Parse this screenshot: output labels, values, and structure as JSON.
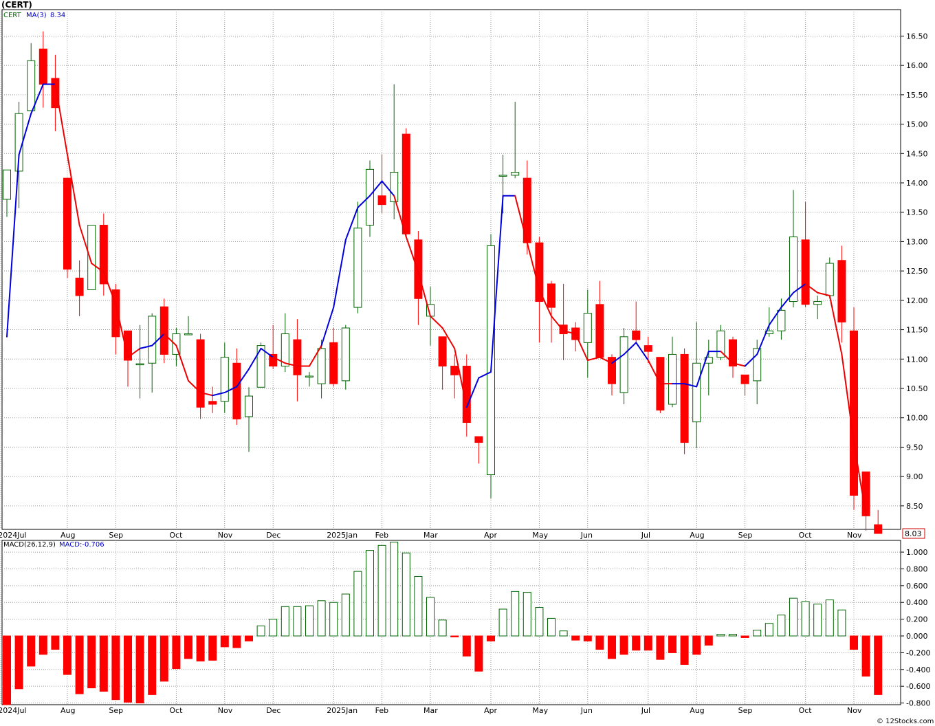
{
  "title": "(CERT)",
  "footer": "© 12Stocks.com",
  "chart_data": [
    {
      "type": "candlestick",
      "legend": {
        "symbol": "CERT",
        "ma_label": "MA(3)",
        "ma_value": "8.34"
      },
      "last_price": "8.03",
      "ylim": [
        8.1,
        16.95
      ],
      "yticks": [
        8.5,
        9.0,
        9.5,
        10.0,
        10.5,
        11.0,
        11.5,
        12.0,
        12.5,
        13.0,
        13.5,
        14.0,
        14.5,
        15.0,
        15.5,
        16.0,
        16.5
      ],
      "ytick_labels": [
        "8.50",
        "9.00",
        "9.50",
        "10.00",
        "10.50",
        "11.00",
        "11.50",
        "12.00",
        "12.50",
        "13.00",
        "13.50",
        "14.00",
        "14.50",
        "15.00",
        "15.50",
        "16.00",
        "16.50"
      ],
      "x_labels": [
        {
          "label": "2024Jul",
          "i": -0.5
        },
        {
          "label": "Aug",
          "i": 5
        },
        {
          "label": "Sep",
          "i": 9
        },
        {
          "label": "Oct",
          "i": 14
        },
        {
          "label": "Nov",
          "i": 18
        },
        {
          "label": "Dec",
          "i": 22
        },
        {
          "label": "2025Jan",
          "i": 27
        },
        {
          "label": "Feb",
          "i": 31
        },
        {
          "label": "Mar",
          "i": 35
        },
        {
          "label": "Apr",
          "i": 40
        },
        {
          "label": "May",
          "i": 44
        },
        {
          "label": "Jun",
          "i": 48
        },
        {
          "label": "Jul",
          "i": 53
        },
        {
          "label": "Aug",
          "i": 57
        },
        {
          "label": "Sep",
          "i": 61
        },
        {
          "label": "Oct",
          "i": 66
        },
        {
          "label": "Nov",
          "i": 70
        }
      ],
      "candles": [
        [
          13.72,
          14.22,
          13.42,
          14.22
        ],
        [
          14.2,
          15.38,
          13.57,
          15.18
        ],
        [
          15.23,
          16.38,
          15.23,
          16.08
        ],
        [
          16.28,
          16.58,
          15.28,
          15.68
        ],
        [
          15.78,
          16.18,
          14.88,
          15.28
        ],
        [
          14.08,
          14.08,
          12.38,
          12.53
        ],
        [
          12.38,
          12.68,
          11.73,
          12.08
        ],
        [
          12.18,
          13.28,
          12.18,
          13.28
        ],
        [
          13.28,
          13.48,
          12.08,
          12.28
        ],
        [
          12.18,
          12.28,
          11.08,
          11.38
        ],
        [
          11.48,
          11.48,
          10.53,
          10.98
        ],
        [
          10.92,
          11.58,
          10.33,
          10.92
        ],
        [
          10.93,
          11.78,
          10.43,
          11.73
        ],
        [
          11.89,
          12.03,
          10.93,
          11.08
        ],
        [
          11.08,
          11.53,
          10.88,
          11.43
        ],
        [
          11.43,
          11.73,
          11.43,
          11.43
        ],
        [
          11.33,
          11.43,
          9.98,
          10.18
        ],
        [
          10.28,
          10.53,
          10.08,
          10.23
        ],
        [
          10.28,
          11.28,
          10.08,
          11.03
        ],
        [
          10.93,
          11.18,
          9.88,
          9.98
        ],
        [
          10.02,
          10.52,
          9.42,
          10.37
        ],
        [
          10.52,
          11.28,
          10.52,
          11.23
        ],
        [
          11.08,
          11.58,
          10.83,
          10.88
        ],
        [
          10.88,
          11.78,
          10.78,
          11.43
        ],
        [
          11.33,
          11.68,
          10.28,
          10.73
        ],
        [
          10.71,
          10.78,
          10.53,
          10.71
        ],
        [
          10.58,
          11.33,
          10.33,
          11.18
        ],
        [
          11.28,
          11.53,
          10.53,
          10.58
        ],
        [
          10.63,
          11.58,
          10.48,
          11.53
        ],
        [
          11.88,
          13.68,
          11.78,
          13.23
        ],
        [
          13.28,
          14.38,
          13.08,
          14.23
        ],
        [
          13.78,
          14.48,
          13.48,
          13.63
        ],
        [
          13.68,
          15.68,
          13.38,
          14.18
        ],
        [
          14.83,
          14.93,
          13.08,
          13.13
        ],
        [
          13.03,
          13.18,
          11.58,
          12.03
        ],
        [
          11.73,
          12.23,
          11.23,
          11.93
        ],
        [
          11.38,
          11.38,
          10.48,
          10.88
        ],
        [
          10.88,
          11.08,
          10.33,
          10.73
        ],
        [
          10.88,
          11.08,
          9.68,
          9.92
        ],
        [
          9.68,
          9.68,
          9.22,
          9.58
        ],
        [
          9.03,
          13.13,
          8.63,
          12.93
        ],
        [
          14.13,
          14.48,
          13.48,
          14.13
        ],
        [
          14.13,
          15.38,
          14.08,
          14.18
        ],
        [
          14.08,
          14.38,
          12.78,
          12.98
        ],
        [
          12.98,
          13.08,
          11.28,
          11.98
        ],
        [
          12.28,
          12.33,
          11.28,
          11.88
        ],
        [
          11.58,
          12.28,
          10.98,
          11.43
        ],
        [
          11.53,
          11.63,
          11.13,
          11.33
        ],
        [
          11.28,
          12.18,
          10.68,
          11.78
        ],
        [
          11.93,
          12.33,
          11.03,
          11.03
        ],
        [
          11.03,
          11.08,
          10.38,
          10.58
        ],
        [
          10.43,
          11.53,
          10.23,
          11.38
        ],
        [
          11.48,
          11.98,
          11.28,
          11.33
        ],
        [
          11.23,
          11.38,
          10.93,
          11.13
        ],
        [
          11.03,
          11.03,
          10.08,
          10.13
        ],
        [
          10.23,
          11.38,
          10.18,
          11.08
        ],
        [
          11.08,
          11.18,
          9.38,
          9.58
        ],
        [
          9.93,
          11.63,
          9.48,
          10.93
        ],
        [
          10.93,
          11.33,
          10.38,
          11.03
        ],
        [
          11.03,
          11.58,
          10.98,
          11.48
        ],
        [
          11.33,
          11.38,
          10.68,
          10.88
        ],
        [
          10.73,
          10.73,
          10.38,
          10.58
        ],
        [
          10.63,
          11.33,
          10.23,
          11.18
        ],
        [
          11.43,
          11.88,
          11.38,
          11.48
        ],
        [
          11.48,
          12.03,
          11.33,
          11.83
        ],
        [
          11.98,
          13.88,
          11.88,
          13.08
        ],
        [
          13.03,
          13.68,
          11.88,
          11.93
        ],
        [
          11.93,
          12.08,
          11.68,
          11.98
        ],
        [
          12.08,
          12.73,
          12.03,
          12.63
        ],
        [
          12.68,
          12.93,
          11.28,
          11.63
        ],
        [
          11.48,
          11.88,
          8.43,
          8.68
        ],
        [
          9.08,
          9.08,
          8.08,
          8.33
        ],
        [
          8.18,
          8.43,
          8.03,
          8.03
        ]
      ],
      "ma3": [
        [
          0,
          11.38
        ],
        [
          1,
          14.48
        ],
        [
          2,
          15.18
        ],
        [
          3,
          15.68
        ],
        [
          4,
          15.68
        ],
        [
          5,
          14.48
        ],
        [
          6,
          13.28
        ],
        [
          7,
          12.63
        ],
        [
          8,
          12.48
        ],
        [
          9,
          11.93
        ],
        [
          10,
          11.03
        ],
        [
          11,
          11.18
        ],
        [
          12,
          11.23
        ],
        [
          13,
          11.43
        ],
        [
          14,
          11.23
        ],
        [
          15,
          10.63
        ],
        [
          16,
          10.43
        ],
        [
          17,
          10.38
        ],
        [
          18,
          10.43
        ],
        [
          19,
          10.53
        ],
        [
          20,
          10.83
        ],
        [
          21,
          11.18
        ],
        [
          22,
          11.03
        ],
        [
          23,
          10.93
        ],
        [
          24,
          10.88
        ],
        [
          25,
          10.88
        ],
        [
          26,
          11.23
        ],
        [
          27,
          11.88
        ],
        [
          28,
          13.03
        ],
        [
          29,
          13.58
        ],
        [
          30,
          13.78
        ],
        [
          31,
          14.03
        ],
        [
          32,
          13.78
        ],
        [
          33,
          13.08
        ],
        [
          34,
          12.48
        ],
        [
          35,
          11.73
        ],
        [
          36,
          11.53
        ],
        [
          37,
          11.18
        ],
        [
          38,
          10.18
        ],
        [
          39,
          10.68
        ],
        [
          40,
          10.78
        ],
        [
          41,
          13.78
        ],
        [
          42,
          13.78
        ],
        [
          43,
          12.98
        ],
        [
          44,
          12.18
        ],
        [
          45,
          11.73
        ],
        [
          46,
          11.48
        ],
        [
          47,
          11.43
        ],
        [
          48,
          10.98
        ],
        [
          49,
          11.03
        ],
        [
          50,
          10.93
        ],
        [
          51,
          11.08
        ],
        [
          52,
          11.28
        ],
        [
          53,
          10.98
        ],
        [
          54,
          10.58
        ],
        [
          55,
          10.58
        ],
        [
          56,
          10.58
        ],
        [
          57,
          10.53
        ],
        [
          58,
          11.13
        ],
        [
          59,
          11.13
        ],
        [
          60,
          10.93
        ],
        [
          61,
          10.88
        ],
        [
          62,
          11.08
        ],
        [
          63,
          11.58
        ],
        [
          64,
          11.88
        ],
        [
          65,
          12.13
        ],
        [
          66,
          12.28
        ],
        [
          67,
          12.13
        ],
        [
          68,
          12.08
        ],
        [
          69,
          11.08
        ],
        [
          70,
          9.58
        ],
        [
          71,
          8.34
        ]
      ],
      "ma3_colors": [
        "blue",
        "blue",
        "blue",
        "blue",
        "red",
        "red",
        "red",
        "red",
        "red",
        "red",
        "red",
        "blue",
        "blue",
        "red",
        "red",
        "red",
        "red",
        "blue",
        "blue",
        "blue",
        "blue",
        "blue",
        "red",
        "red",
        "red",
        "red",
        "blue",
        "blue",
        "blue",
        "blue",
        "blue",
        "blue",
        "red",
        "red",
        "red",
        "red",
        "red",
        "red",
        "blue",
        "blue",
        "blue",
        "blue",
        "red",
        "red",
        "red",
        "red",
        "red",
        "red",
        "red",
        "red",
        "blue",
        "blue",
        "blue",
        "red",
        "red",
        "blue",
        "blue",
        "blue",
        "blue",
        "red",
        "red",
        "blue",
        "blue",
        "blue",
        "blue",
        "blue",
        "red",
        "red",
        "red",
        "red",
        "red"
      ]
    },
    {
      "type": "bar",
      "name": "MACD histogram",
      "legend": {
        "label": "MACD(26,12,9)",
        "value_label": "MACD:-0.706"
      },
      "ylim": [
        -0.82,
        1.14
      ],
      "yticks": [
        -0.8,
        -0.6,
        -0.4,
        -0.2,
        0.0,
        0.2,
        0.4,
        0.6,
        0.8,
        1.0
      ],
      "ytick_labels": [
        "-0.800",
        "-0.600",
        "-0.400",
        "-0.200",
        "0.000",
        "0.200",
        "0.400",
        "0.600",
        "0.800",
        "1.000"
      ],
      "x_labels": [
        {
          "label": "2024Jul",
          "i": -0.5
        },
        {
          "label": "Aug",
          "i": 5
        },
        {
          "label": "Sep",
          "i": 9
        },
        {
          "label": "Oct",
          "i": 14
        },
        {
          "label": "Nov",
          "i": 18
        },
        {
          "label": "Dec",
          "i": 22
        },
        {
          "label": "2025Jan",
          "i": 27
        },
        {
          "label": "Feb",
          "i": 31
        },
        {
          "label": "Mar",
          "i": 35
        },
        {
          "label": "Apr",
          "i": 40
        },
        {
          "label": "May",
          "i": 44
        },
        {
          "label": "Jun",
          "i": 48
        },
        {
          "label": "Jul",
          "i": 53
        },
        {
          "label": "Aug",
          "i": 57
        },
        {
          "label": "Sep",
          "i": 61
        },
        {
          "label": "Oct",
          "i": 66
        },
        {
          "label": "Nov",
          "i": 70
        }
      ],
      "values": [
        -0.82,
        -0.63,
        -0.36,
        -0.22,
        -0.16,
        -0.46,
        -0.69,
        -0.62,
        -0.66,
        -0.76,
        -0.79,
        -0.8,
        -0.7,
        -0.54,
        -0.39,
        -0.27,
        -0.3,
        -0.29,
        -0.13,
        -0.14,
        -0.06,
        0.12,
        0.2,
        0.35,
        0.35,
        0.36,
        0.42,
        0.4,
        0.5,
        0.77,
        1.02,
        1.08,
        1.12,
        0.99,
        0.71,
        0.46,
        0.19,
        -0.01,
        -0.24,
        -0.42,
        -0.06,
        0.32,
        0.53,
        0.52,
        0.34,
        0.21,
        0.06,
        -0.05,
        -0.06,
        -0.16,
        -0.27,
        -0.22,
        -0.17,
        -0.17,
        -0.28,
        -0.2,
        -0.34,
        -0.22,
        -0.11,
        0.02,
        0.02,
        -0.02,
        0.07,
        0.15,
        0.25,
        0.45,
        0.41,
        0.38,
        0.43,
        0.31,
        -0.16,
        -0.48,
        -0.7
      ]
    }
  ]
}
